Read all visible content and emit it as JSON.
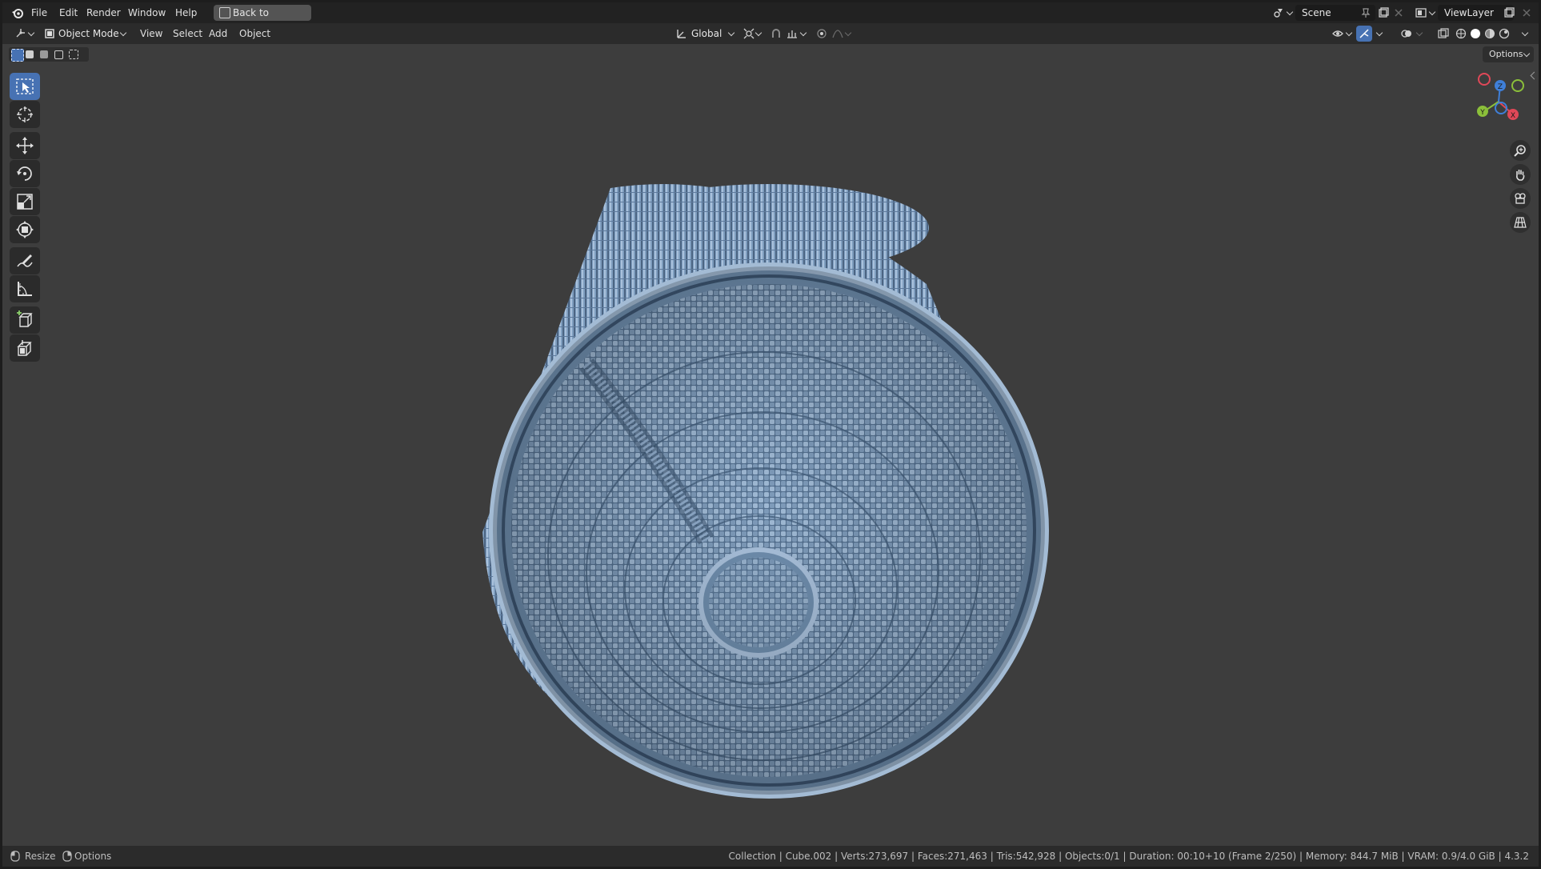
{
  "menu": {
    "file": "File",
    "edit": "Edit",
    "render": "Render",
    "window": "Window",
    "help": "Help",
    "back_to_previous": "Back to Previous"
  },
  "scene": {
    "name": "Scene"
  },
  "view_layer": {
    "name": "ViewLayer"
  },
  "header": {
    "mode": "Object Mode",
    "view": "View",
    "select": "Select",
    "add": "Add",
    "object": "Object",
    "transform_orientation": "Global",
    "options": "Options"
  },
  "toolbar": {
    "tools": [
      "select-box",
      "cursor",
      "move",
      "rotate",
      "scale",
      "transform",
      "annotate",
      "measure",
      "add-cube",
      "extrude-cube"
    ],
    "active_tool": "select-box"
  },
  "gizmo": {
    "x": "X",
    "y": "Y",
    "z": "Z",
    "x_color": "#e04858",
    "y_color": "#8bbf3a",
    "z_color": "#3f7fd8"
  },
  "viewport": {
    "object_color": "#7f9ebf",
    "background": "#3d3d3d"
  },
  "statusbar": {
    "resize": "Resize",
    "options": "Options",
    "stats": "Collection | Cube.002 | Verts:273,697 | Faces:271,463 | Tris:542,928 | Objects:0/1 | Duration: 00:10+10 (Frame 2/250) | Memory: 844.7 MiB | VRAM: 0.9/4.0 GiB | 4.3.2"
  }
}
